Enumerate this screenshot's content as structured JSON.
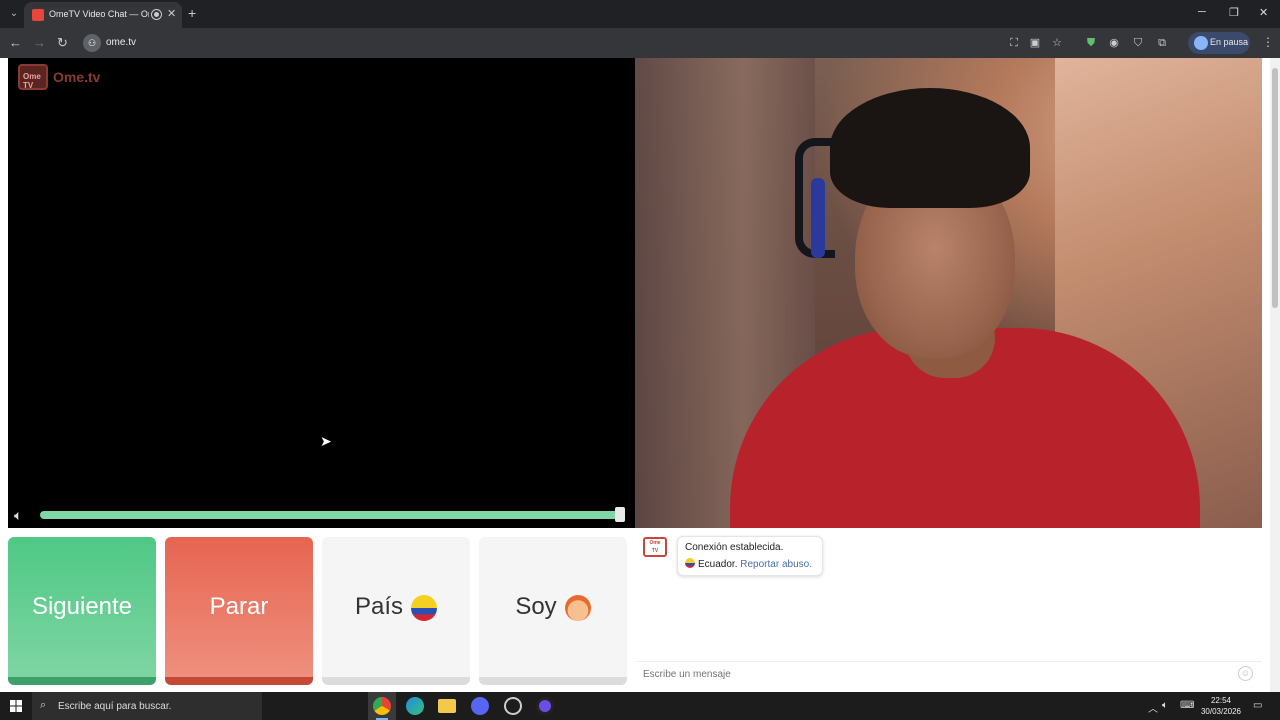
{
  "browser": {
    "tab_title": "OmeTV Video Chat — Om...",
    "tab_close": "✕",
    "new_tab": "+",
    "url": "ome.tv",
    "profile_label": "En pausa"
  },
  "page": {
    "logo_text": "Ome.tv",
    "logo_tv_text": "Ome TV",
    "buttons": {
      "next": "Siguiente",
      "stop": "Parar",
      "country": "País",
      "gender": "Soy"
    },
    "chat": {
      "system_line1": "Conexión establecida.",
      "country_name": "Ecuador.",
      "report_link": "Reportar abuso.",
      "input_placeholder": "Escribe un mensaje"
    }
  },
  "taskbar": {
    "search_placeholder": "Escribe aquí para buscar.",
    "time": "22:54",
    "date": "30/03/2026"
  },
  "colors": {
    "next_green": "#4fc885",
    "stop_red": "#e66551",
    "volume_track": "#7fd6a6"
  }
}
